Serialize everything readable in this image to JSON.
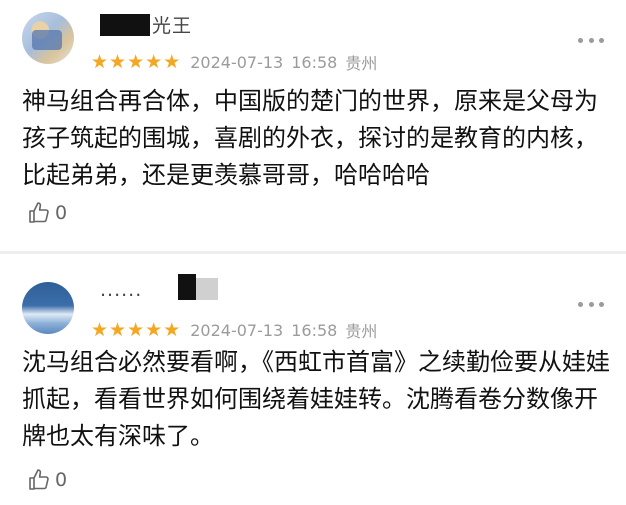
{
  "reviews": [
    {
      "username_visible": "光王",
      "rating_stars": 5,
      "date": "2024-07-13",
      "time": "16:58",
      "location": "贵州",
      "content": "神马组合再合体，中国版的楚门的世界，原来是父母为孩子筑起的围城，喜剧的外衣，探讨的是教育的内核，比起弟弟，还是更羡慕哥哥，哈哈哈哈",
      "likes": "0"
    },
    {
      "username_visible": "......",
      "rating_stars": 5,
      "date": "2024-07-13",
      "time": "16:58",
      "location": "贵州",
      "content": "沈马组合必然要看啊，《西虹市首富》之续勤俭要从娃娃抓起，看看世界如何围绕着娃娃转。沈腾看卷分数像开牌也太有深味了。",
      "likes": "0"
    }
  ],
  "colors": {
    "star": "#f5a623",
    "meta_text": "#9b9b9b",
    "divider": "#eeeeee"
  },
  "icons": {
    "star": "star-icon",
    "like": "thumbs-up-icon",
    "more": "more-options-icon"
  }
}
